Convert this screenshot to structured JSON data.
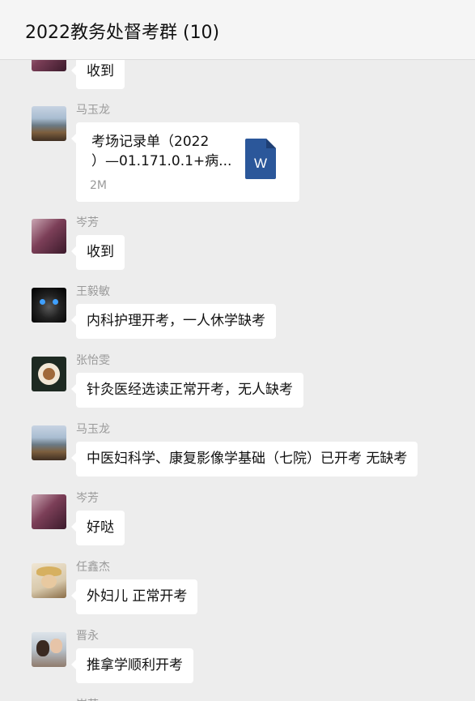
{
  "header": {
    "title": "2022教务处督考群 (10)"
  },
  "messages": [
    {
      "sender": "",
      "avatar": "girl-photo",
      "text": "收到"
    },
    {
      "sender": "马玉龙",
      "avatar": "mountain-photo",
      "file": {
        "name_line1": "考场记录单（2022",
        "name_line2": "）—01.171.0.1+病...",
        "size": "2M",
        "icon": "word-doc-icon",
        "icon_letter": "W",
        "icon_color": "#2b579a"
      }
    },
    {
      "sender": "岑芳",
      "avatar": "girl-photo",
      "text": "收到"
    },
    {
      "sender": "王毅敏",
      "avatar": "cat-photo",
      "text": "内科护理开考，一人休学缺考"
    },
    {
      "sender": "张怡雯",
      "avatar": "coffee-photo",
      "text": "针灸医经选读正常开考，无人缺考"
    },
    {
      "sender": "马玉龙",
      "avatar": "mountain-photo",
      "text": "中医妇科学、康复影像学基础（七院）已开考 无缺考"
    },
    {
      "sender": "岑芳",
      "avatar": "girl-photo",
      "text": "好哒"
    },
    {
      "sender": "任鑫杰",
      "avatar": "doll-photo",
      "text": "外妇儿 正常开考"
    },
    {
      "sender": "晋永",
      "avatar": "people-photo",
      "text": "推拿学顺利开考"
    },
    {
      "sender": "岑芳",
      "avatar": "girl-photo"
    }
  ]
}
